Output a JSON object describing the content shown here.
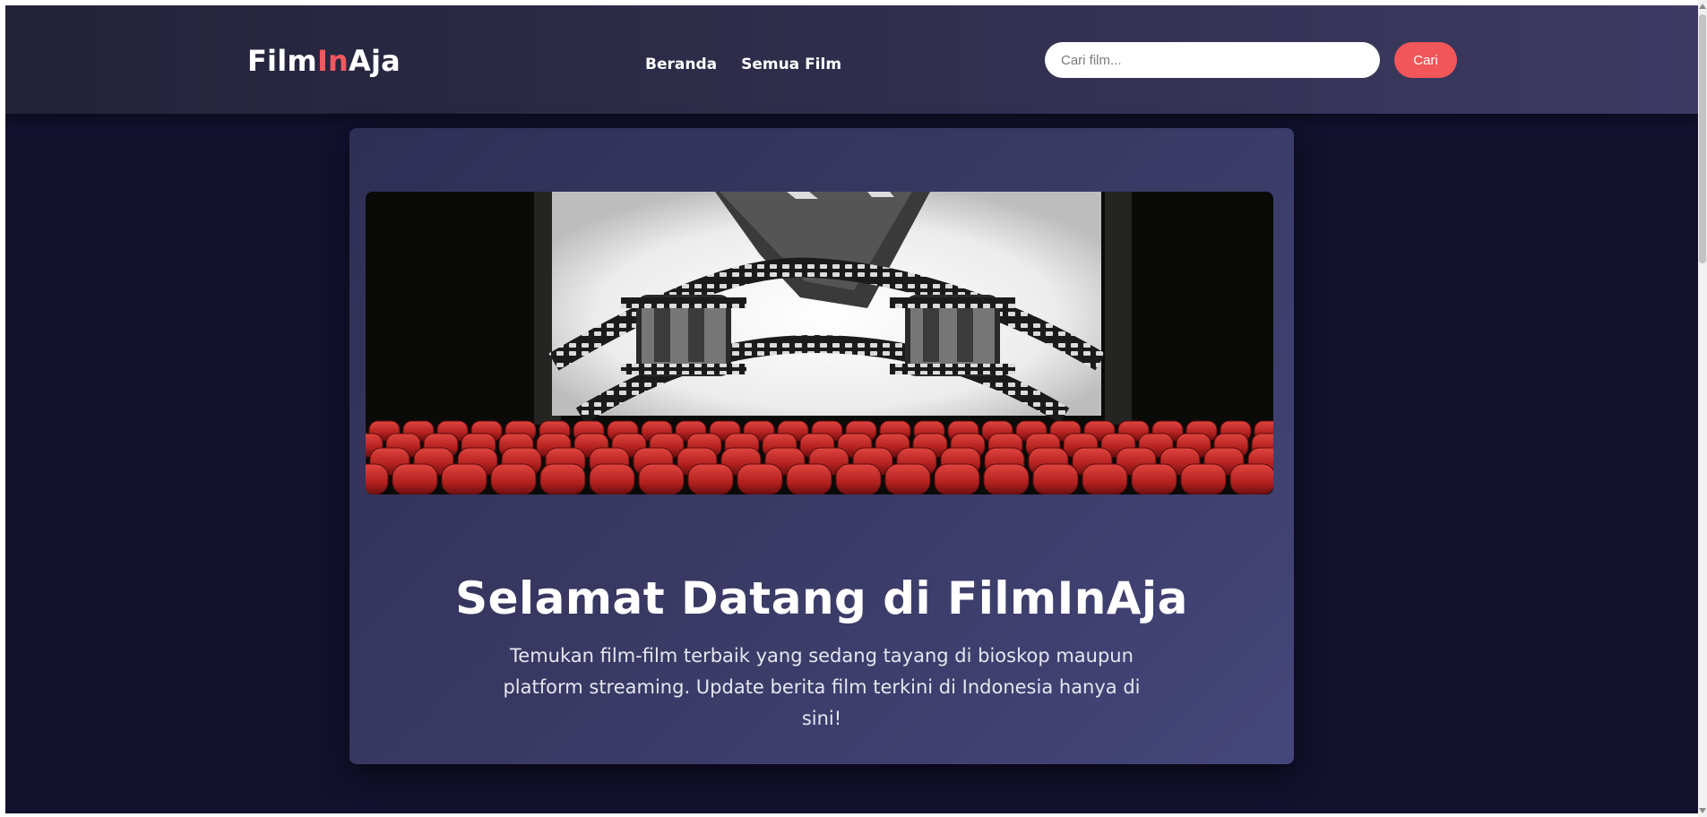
{
  "header": {
    "logo": {
      "part1": "Film",
      "part2": "In",
      "part3": "Aja"
    },
    "nav": [
      {
        "label": "Beranda"
      },
      {
        "label": "Semua Film"
      }
    ],
    "search": {
      "placeholder": "Cari film...",
      "value": "",
      "button_label": "Cari"
    }
  },
  "hero": {
    "image_icon": "cinema-screen-film-reel-illustration",
    "title": "Selamat Datang di FilmInAja",
    "description": "Temukan film-film terbaik yang sedang tayang di bioskop maupun platform streaming. Update berita film terkini di Indonesia hanya di sini!"
  },
  "colors": {
    "accent": "#f05a5f",
    "button": "#f15658",
    "background": "#12112e",
    "card": "#383862",
    "seat": "#c0262b"
  }
}
